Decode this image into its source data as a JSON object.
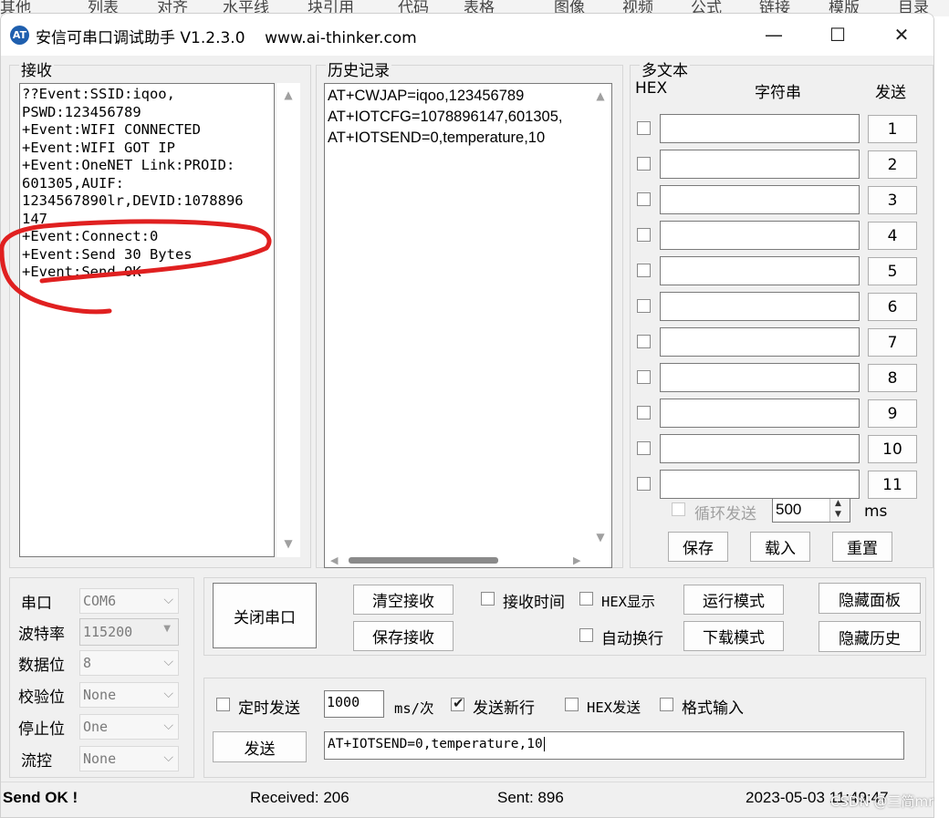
{
  "background_toolbar": [
    "其他",
    "列表",
    "对齐",
    "水平线",
    "块引用",
    "代码",
    "表格",
    "图像",
    "视频",
    "公式",
    "链接",
    "模版",
    "目录"
  ],
  "window": {
    "logo_text": "AT",
    "title": "安信可串口调试助手 V1.2.3.0",
    "site": "www.ai-thinker.com",
    "minimize": "—",
    "maximize": "☐",
    "close": "✕"
  },
  "receive": {
    "label": "接收",
    "lines": [
      "??Event:SSID:iqoo,",
      "PSWD:123456789",
      "+Event:WIFI CONNECTED",
      "+Event:WIFI GOT IP",
      "+Event:OneNET Link:PROID:",
      "601305,AUIF:",
      "1234567890lr,DEVID:1078896",
      "147",
      "+Event:Connect:0",
      "+Event:Send 30 Bytes",
      "+Event:Send OK"
    ]
  },
  "history": {
    "label": "历史记录",
    "lines": [
      "AT+CWJAP=iqoo,123456789",
      "AT+IOTCFG=1078896147,601305,",
      "AT+IOTSEND=0,temperature,10"
    ]
  },
  "multitext": {
    "label": "多文本",
    "col_hex": "HEX",
    "col_string": "字符串",
    "col_send": "发送",
    "rows": [
      {
        "send": "1",
        "value": ""
      },
      {
        "send": "2",
        "value": ""
      },
      {
        "send": "3",
        "value": ""
      },
      {
        "send": "4",
        "value": ""
      },
      {
        "send": "5",
        "value": ""
      },
      {
        "send": "6",
        "value": ""
      },
      {
        "send": "7",
        "value": ""
      },
      {
        "send": "8",
        "value": ""
      },
      {
        "send": "9",
        "value": ""
      },
      {
        "send": "10",
        "value": ""
      },
      {
        "send": "11",
        "value": ""
      }
    ],
    "loop_send": "循环发送",
    "interval": "500",
    "unit": "ms",
    "save": "保存",
    "load": "载入",
    "reset": "重置"
  },
  "serial": {
    "port_label": "串口",
    "port_value": "COM6",
    "baud_label": "波特率",
    "baud_value": "115200",
    "data_label": "数据位",
    "data_value": "8",
    "parity_label": "校验位",
    "parity_value": "None",
    "stop_label": "停止位",
    "stop_value": "One",
    "flow_label": "流控",
    "flow_value": "None"
  },
  "controls": {
    "close_port": "关闭串口",
    "clear_recv": "清空接收",
    "save_recv": "保存接收",
    "recv_time": "接收时间",
    "hex_display": "HEX显示",
    "run_mode": "运行模式",
    "hide_panel": "隐藏面板",
    "auto_wrap": "自动换行",
    "download_mode": "下载模式",
    "hide_history": "隐藏历史"
  },
  "send": {
    "timed_send": "定时发送",
    "interval": "1000",
    "interval_unit": "ms/次",
    "new_line": "发送新行",
    "hex_send": "HEX发送",
    "format_input": "格式输入",
    "send_button": "发送",
    "input_value": "AT+IOTSEND=0,temperature,10"
  },
  "status": {
    "message": "Send OK !",
    "received": "Received: 206",
    "sent": "Sent: 896",
    "datetime": "2023-05-03 11:49:47",
    "watermark": "CSDN @三简mr"
  },
  "colors": {
    "annotation": "#e02020"
  }
}
